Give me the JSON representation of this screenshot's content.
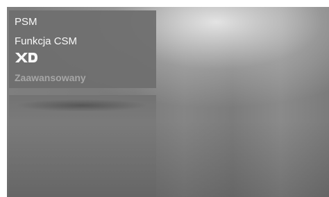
{
  "menu": {
    "items": [
      {
        "label": "PSM",
        "state": "normal"
      },
      {
        "label": "Funkcja CSM",
        "state": "normal"
      },
      {
        "label": "XD",
        "icon": "xd-logo-icon",
        "state": "normal"
      },
      {
        "label": "Zaawansowany",
        "state": "disabled"
      }
    ]
  },
  "colors": {
    "menu_bg": "#6f6f6f",
    "text_active": "#ffffff",
    "text_disabled": "#a9a9a9",
    "screen_bg": "#7f7f7f"
  }
}
